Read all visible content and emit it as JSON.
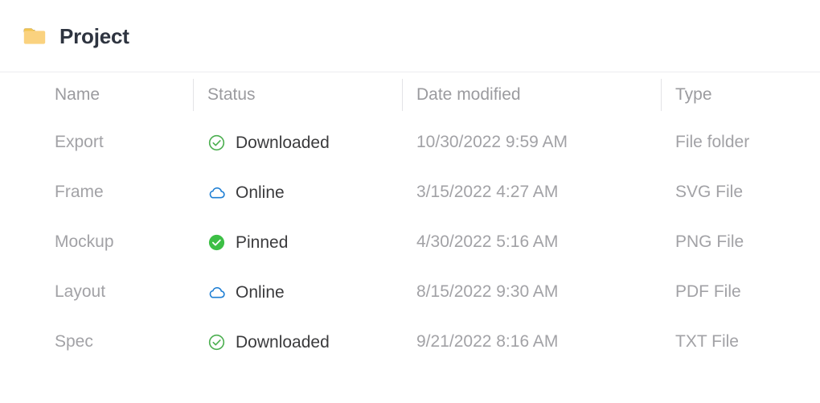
{
  "header": {
    "title": "Project",
    "folder_icon": "folder-icon",
    "folder_color": "#f7d070"
  },
  "table": {
    "columns": [
      {
        "key": "name",
        "label": "Name"
      },
      {
        "key": "status",
        "label": "Status"
      },
      {
        "key": "date",
        "label": "Date modified"
      },
      {
        "key": "type",
        "label": "Type"
      }
    ],
    "rows": [
      {
        "name": "Export",
        "status": "Downloaded",
        "status_icon": "check-circle-outline-icon",
        "status_color": "#4caf50",
        "date": "10/30/2022 9:59 AM",
        "type": "File folder"
      },
      {
        "name": "Frame",
        "status": "Online",
        "status_icon": "cloud-outline-icon",
        "status_color": "#1f7fd4",
        "date": "3/15/2022 4:27 AM",
        "type": "SVG File"
      },
      {
        "name": "Mockup",
        "status": "Pinned",
        "status_icon": "check-circle-filled-icon",
        "status_color": "#3cbf45",
        "date": "4/30/2022 5:16 AM",
        "type": "PNG File"
      },
      {
        "name": "Layout",
        "status": "Online",
        "status_icon": "cloud-outline-icon",
        "status_color": "#1f7fd4",
        "date": "8/15/2022 9:30 AM",
        "type": "PDF File"
      },
      {
        "name": "Spec",
        "status": "Downloaded",
        "status_icon": "check-circle-outline-icon",
        "status_color": "#4caf50",
        "date": "9/21/2022 8:16 AM",
        "type": "TXT File"
      }
    ]
  }
}
